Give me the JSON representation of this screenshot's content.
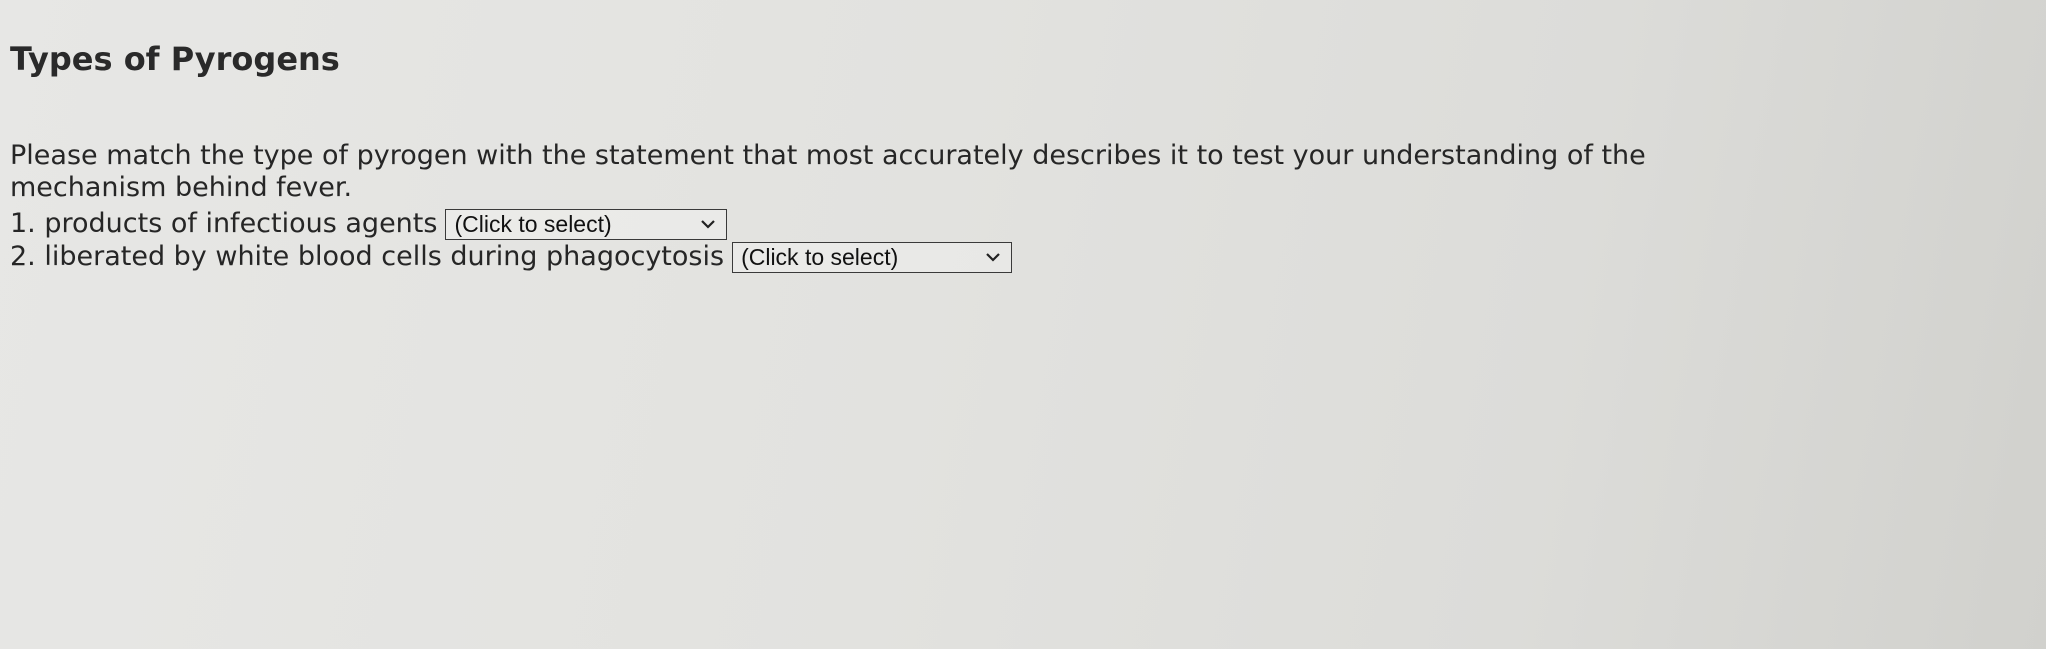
{
  "page": {
    "title": "Types of Pyrogens",
    "instructions": "Please match the type of pyrogen with the statement that most accurately describes it to test your understanding of the mechanism behind fever."
  },
  "questions": [
    {
      "label": "1. products of infectious agents",
      "select_value": "(Click to select)",
      "icon": "chevron-down-icon"
    },
    {
      "label": "2. liberated by white blood cells during phagocytosis",
      "select_value": "(Click to select)",
      "icon": "chevron-down-icon"
    }
  ]
}
